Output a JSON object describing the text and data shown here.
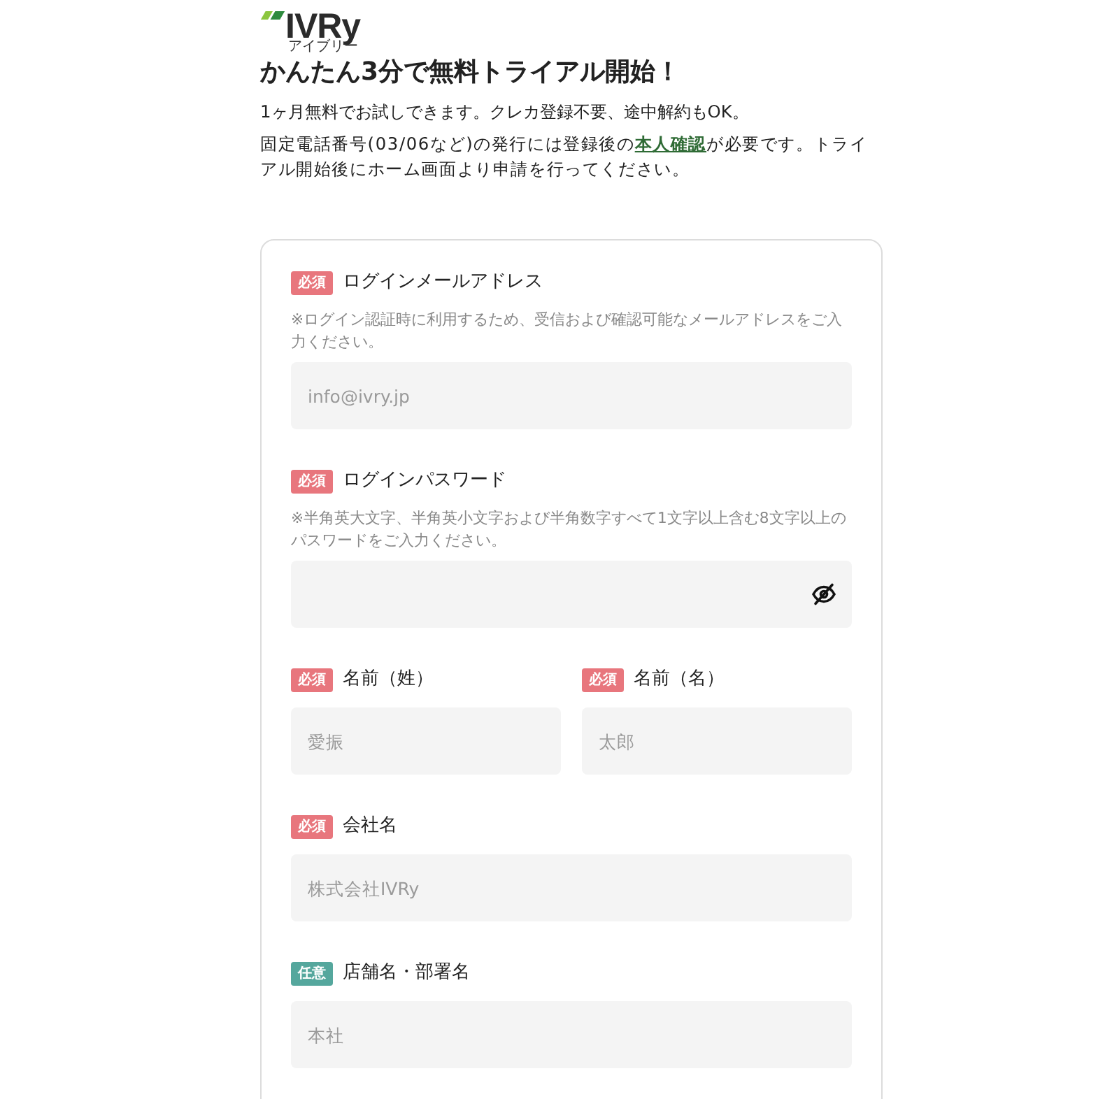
{
  "logo": {
    "wordmark": "IVRy",
    "reading": "アイブリー"
  },
  "heading": "かんたん3分で無料トライアル開始！",
  "intro": {
    "lead": "1ヶ月無料でお試しできます。クレカ登録不要、途中解約もOK。",
    "notice": {
      "before": "固定電話番号(03/06など)の発行には登録後の",
      "link": "本人確認",
      "after": "が必要です。トライアル開始後にホーム画面より申請を行ってください。"
    }
  },
  "form": {
    "rows": [
      {
        "fields": [
          {
            "kind": "text",
            "required": true,
            "badge": "必須",
            "label": "ログインメールアドレス",
            "note": "※ログイン認証時に利用するため、受信および確認可能なメールアドレスをご入力ください。",
            "placeholder": "info@ivry.jp"
          }
        ]
      },
      {
        "fields": [
          {
            "kind": "password",
            "required": true,
            "badge": "必須",
            "label": "ログインパスワード",
            "note": "※半角英大文字、半角英小文字および半角数字すべて1文字以上含む8文字以上のパスワードをご入力ください。"
          }
        ]
      },
      {
        "fields": [
          {
            "kind": "text",
            "required": true,
            "badge": "必須",
            "label": "名前（姓）",
            "placeholder": "愛振"
          },
          {
            "kind": "text",
            "required": true,
            "badge": "必須",
            "label": "名前（名）",
            "placeholder": "太郎"
          }
        ]
      },
      {
        "fields": [
          {
            "kind": "text",
            "required": true,
            "badge": "必須",
            "label": "会社名",
            "placeholder": "株式会社IVRy"
          }
        ]
      },
      {
        "fields": [
          {
            "kind": "text",
            "required": false,
            "badge": "任意",
            "label": "店舗名・部署名",
            "placeholder": "本社"
          }
        ]
      }
    ]
  }
}
